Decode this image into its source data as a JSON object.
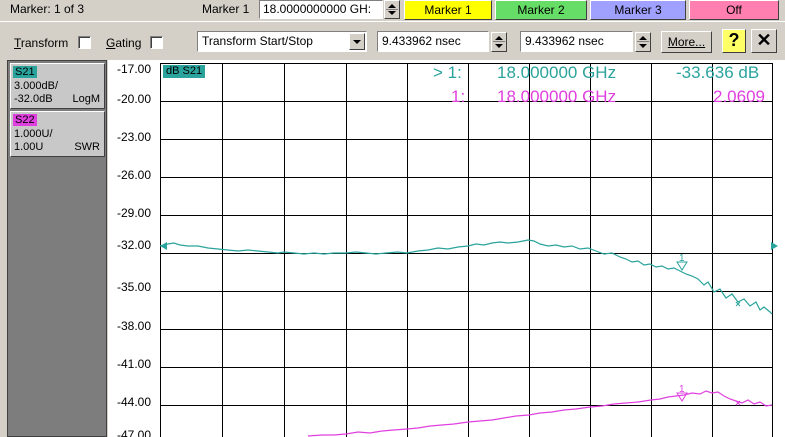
{
  "marker_bar": {
    "count_text": "Marker: 1 of 3",
    "marker_label": "Marker 1",
    "marker_value": "18.0000000000 GH:",
    "buttons": [
      {
        "label": "Marker 1",
        "color": "#ffff00"
      },
      {
        "label": "Marker 2",
        "color": "#66dd66"
      },
      {
        "label": "Marker 3",
        "color": "#a0a0ff"
      },
      {
        "label": "Off",
        "color": "#ff80b0"
      }
    ]
  },
  "transform_bar": {
    "transform_label": "Transform",
    "transform_mnemonic": "T",
    "transform_rest": "ransform",
    "gating_label": "Gating",
    "gating_mnemonic": "G",
    "gating_rest": "ating",
    "mode_value": "Transform Start/Stop",
    "start_value": "9.433962 nsec",
    "stop_value": "9.433962 nsec",
    "more_label": "More...",
    "help_glyph": "?",
    "close_glyph": "✕"
  },
  "traces": [
    {
      "name": "S21",
      "line2": "3.000dB/",
      "line3": "-32.0dB",
      "format": "LogM",
      "color": "#2aa39c"
    },
    {
      "name": "S22",
      "line2": "1.000U/",
      "line3": "1.00U",
      "format": "SWR",
      "color": "#e040e0"
    }
  ],
  "plot": {
    "y_ticks": [
      "-17.00",
      "-20.00",
      "-23.00",
      "-26.00",
      "-29.00",
      "-32.00",
      "-35.00",
      "-38.00",
      "-41.00",
      "-44.00",
      "-47.00"
    ],
    "trace_tag": "dB S21",
    "readout1": {
      "prefix": "> 1:",
      "freq": "18.000000 GHz",
      "value": "-33.636 dB",
      "color": "#2aa39c"
    },
    "readout2": {
      "prefix": "1:",
      "freq": "18.000000 GHz",
      "value": "2.0609",
      "color": "#e040e0"
    },
    "marker_label": "1"
  }
}
